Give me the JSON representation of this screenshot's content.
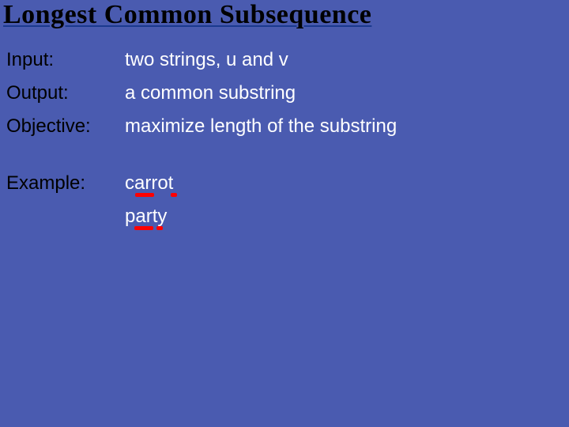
{
  "title": "Longest Common Subsequence",
  "rows": {
    "input": {
      "label": "Input:",
      "value": "two strings,  u and v"
    },
    "output": {
      "label": "Output:",
      "value": "a common substring"
    },
    "objective": {
      "label": "Objective:",
      "value": "maximize length of the substring"
    },
    "example": {
      "label": "Example:"
    }
  },
  "example_words": {
    "w1": "carrot",
    "w2": "party"
  }
}
